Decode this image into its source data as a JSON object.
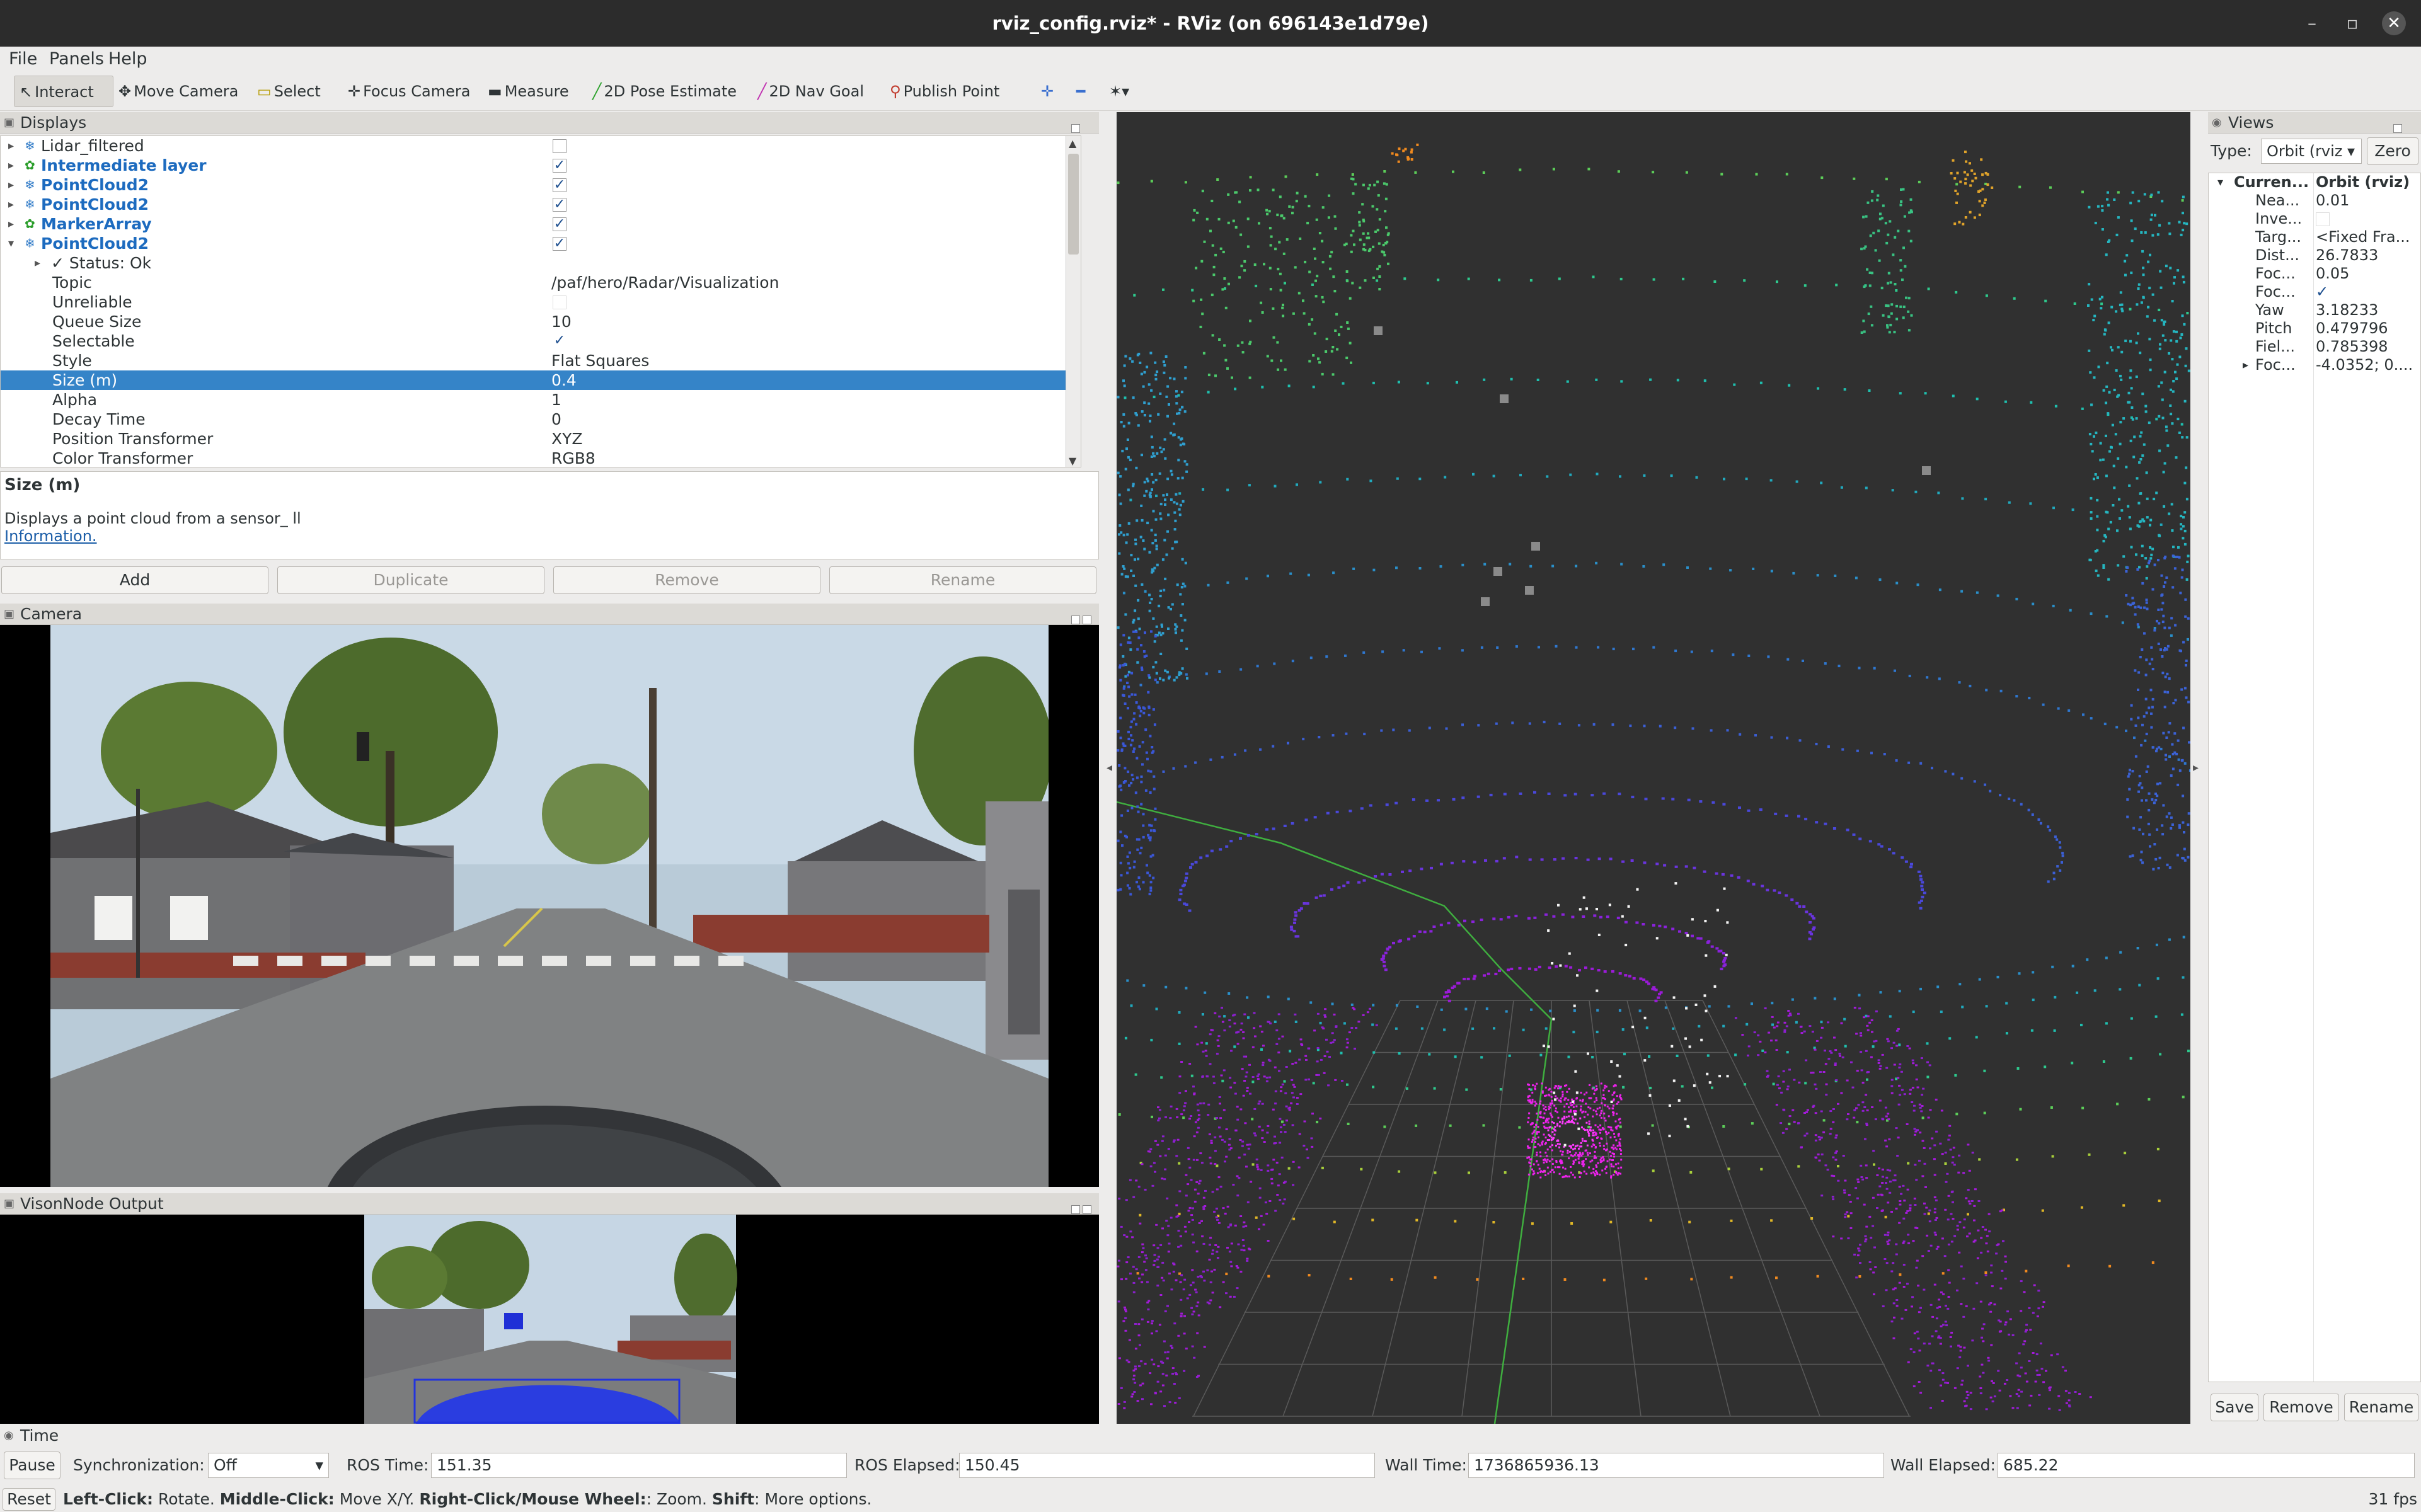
{
  "window": {
    "title": "rviz_config.rviz* - RViz (on 696143e1d79e)"
  },
  "menu": [
    "File",
    "Panels",
    "Help"
  ],
  "toolbar": {
    "tools": [
      "Interact",
      "Move Camera",
      "Select",
      "Focus Camera",
      "Measure",
      "2D Pose Estimate",
      "2D Nav Goal",
      "Publish Point"
    ]
  },
  "displays": {
    "title": "Displays",
    "items": [
      {
        "name": "Lidar_filtered",
        "checked": false
      },
      {
        "name": "Intermediate layer",
        "checked": true
      },
      {
        "name": "PointCloud2",
        "checked": true
      },
      {
        "name": "PointCloud2",
        "checked": true
      },
      {
        "name": "MarkerArray",
        "checked": true
      },
      {
        "name": "PointCloud2",
        "checked": true
      }
    ],
    "status": "Status: Ok",
    "properties": [
      {
        "name": "Topic",
        "value": "/paf/hero/Radar/Visualization"
      },
      {
        "name": "Unreliable",
        "value": ""
      },
      {
        "name": "Queue Size",
        "value": "10"
      },
      {
        "name": "Selectable",
        "value": ""
      },
      {
        "name": "Style",
        "value": "Flat Squares"
      },
      {
        "name": "Size (m)",
        "value": "0.4"
      },
      {
        "name": "Alpha",
        "value": "1"
      },
      {
        "name": "Decay Time",
        "value": "0"
      },
      {
        "name": "Position Transformer",
        "value": "XYZ"
      },
      {
        "name": "Color Transformer",
        "value": "RGB8"
      }
    ],
    "description_title": "Size (m)",
    "description_text": "Displays a point cloud from a sensor_ ll",
    "description_link": "Information."
  },
  "buttons": {
    "add": "Add",
    "duplicate": "Duplicate",
    "remove": "Remove",
    "rename": "Rename"
  },
  "camera_panel": {
    "title": "Camera"
  },
  "vision_panel": {
    "title": "VisonNode Output"
  },
  "views": {
    "title": "Views",
    "type_label": "Type:",
    "type_value": "Orbit (rviz",
    "zero_button": "Zero",
    "current_name": "Curren...",
    "current_value": "Orbit (rviz)",
    "props": [
      {
        "name": "Nea...",
        "value": "0.01"
      },
      {
        "name": "Inve...",
        "value": ""
      },
      {
        "name": "Targ...",
        "value": "<Fixed Fra..."
      },
      {
        "name": "Dist...",
        "value": "26.7833"
      },
      {
        "name": "Foc...",
        "value": "0.05"
      },
      {
        "name": "Foc...",
        "value": "✓"
      },
      {
        "name": "Yaw",
        "value": "3.18233"
      },
      {
        "name": "Pitch",
        "value": "0.479796"
      },
      {
        "name": "Fiel...",
        "value": "0.785398"
      },
      {
        "name": "Foc...",
        "value": "-4.0352; 0...."
      }
    ],
    "save": "Save",
    "remove": "Remove",
    "rename": "Rename"
  },
  "time": {
    "title": "Time",
    "pause": "Pause",
    "sync_label": "Synchronization:",
    "sync_value": "Off",
    "ros_time_label": "ROS Time:",
    "ros_time": "151.35",
    "ros_elapsed_label": "ROS Elapsed:",
    "ros_elapsed": "150.45",
    "wall_time_label": "Wall Time:",
    "wall_time": "1736865936.13",
    "wall_elapsed_label": "Wall Elapsed:",
    "wall_elapsed": "685.22"
  },
  "status": {
    "reset": "Reset",
    "left_click": "Left-Click:",
    "left_text": "Rotate.",
    "middle_click": "Middle-Click:",
    "middle_text": "Move X/Y.",
    "right_click": "Right-Click/Mouse Wheel:",
    "right_text": ": Zoom.",
    "shift": "Shift",
    "shift_text": ": More options.",
    "fps": "31 fps"
  }
}
